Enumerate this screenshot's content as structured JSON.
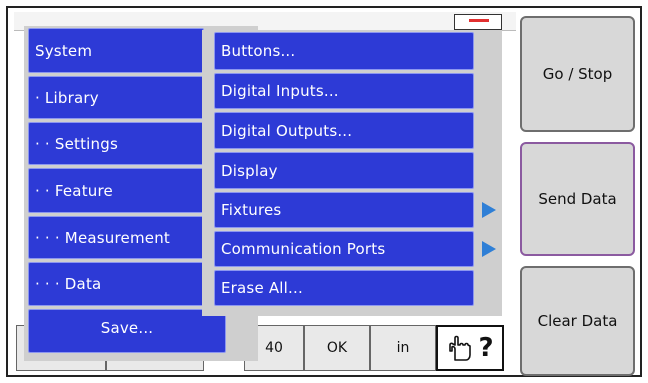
{
  "side_buttons": {
    "go_stop": "Go / Stop",
    "send_data": "Send Data",
    "clear_data": "Clear Data"
  },
  "status_bar": {
    "value": "40",
    "ok": "OK",
    "unit": "in",
    "help_glyph": "?"
  },
  "main_menu": {
    "items": [
      "System",
      "· Library",
      "· · Settings",
      "· · Feature",
      "· · · Measurement",
      "· · · Data"
    ],
    "save": "Save..."
  },
  "sub_menu": {
    "items": [
      "Buttons...",
      "Digital Inputs...",
      "Digital Outputs...",
      "Display",
      "Fixtures",
      "Communication Ports",
      "Erase All..."
    ],
    "arrow_items": [
      4,
      5
    ]
  },
  "colors": {
    "menu_blue": "#2d3ad6",
    "arrow_blue": "#2f7fd6",
    "active_border": "#8b5aa0"
  },
  "icons": [
    "hand-pointer-icon",
    "submenu-arrow-icon"
  ]
}
